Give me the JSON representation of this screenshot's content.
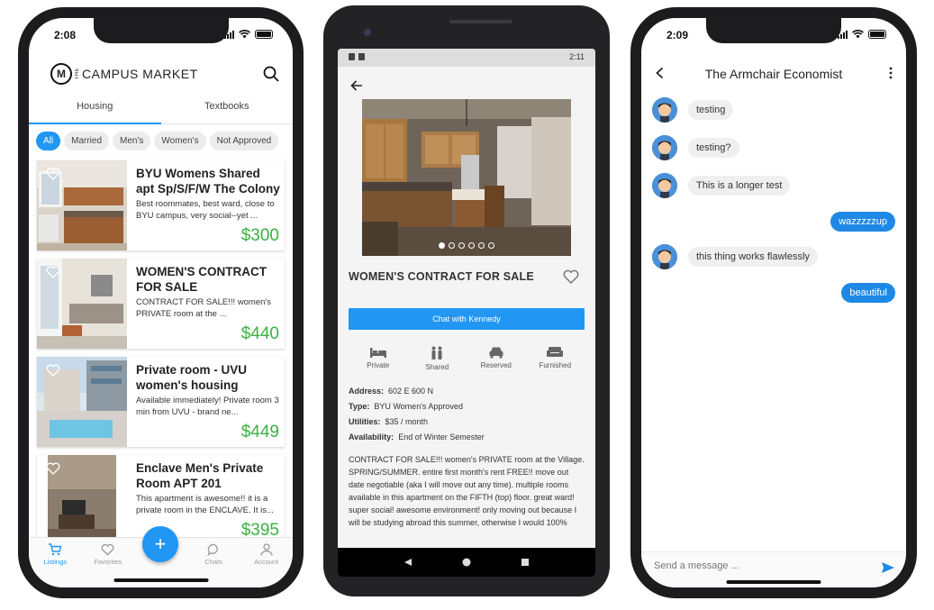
{
  "phone1": {
    "status_time": "2:08",
    "brand": {
      "letter": "M",
      "the": "THE",
      "name": "CAMPUS MARKET"
    },
    "tabs": [
      {
        "label": "Housing",
        "active": true
      },
      {
        "label": "Textbooks",
        "active": false
      }
    ],
    "filters": [
      {
        "label": "All",
        "active": true
      },
      {
        "label": "Married"
      },
      {
        "label": "Men's"
      },
      {
        "label": "Women's"
      },
      {
        "label": "Not Approved"
      }
    ],
    "listings": [
      {
        "title": "BYU Womens Shared apt Sp/S/F/W The Colony",
        "desc": "Best roommates, best ward, close to BYU campus, very social--yet ...",
        "price": "$300"
      },
      {
        "title": "WOMEN'S CONTRACT FOR SALE",
        "desc": "CONTRACT FOR SALE!!! women's PRIVATE room at the ...",
        "price": "$440"
      },
      {
        "title": "Private room - UVU women's housing",
        "desc": "Available immediately! Private room 3 min from UVU - brand ne...",
        "price": "$449"
      },
      {
        "title": "Enclave Men's Private Room APT 201",
        "desc": "This apartment is awesome!! it is a private room in the ENCLAVE. It is...",
        "price": "$395"
      }
    ],
    "fab_label": "+",
    "bottom_nav": [
      {
        "label": "Listings",
        "icon": "cart-icon",
        "active": true
      },
      {
        "label": "Favorites",
        "icon": "heart-icon"
      },
      {
        "label": "",
        "icon": ""
      },
      {
        "label": "Chats",
        "icon": "chat-icon"
      },
      {
        "label": "Account",
        "icon": "person-icon"
      }
    ],
    "accent_color": "#2196f3",
    "price_color": "#3cb043"
  },
  "phone2": {
    "status_time": "2:11",
    "title": "WOMEN'S CONTRACT FOR SALE",
    "chat_button": "Chat with Kennedy",
    "image_count": 6,
    "active_image": 0,
    "amenities": [
      {
        "label": "Private",
        "icon": "bed-icon"
      },
      {
        "label": "Shared",
        "icon": "people-icon"
      },
      {
        "label": "Reserved",
        "icon": "car-icon"
      },
      {
        "label": "Furnished",
        "icon": "sofa-icon"
      }
    ],
    "properties": [
      {
        "key": "Address:",
        "value": "602 E 600 N"
      },
      {
        "key": "Type:",
        "value": "BYU Women's Approved"
      },
      {
        "key": "Utilities:",
        "value": "$35 / month"
      },
      {
        "key": "Availability:",
        "value": "End of Winter Semester"
      }
    ],
    "description": "CONTRACT FOR SALE!!! women's PRIVATE room at the Village. SPRING/SUMMER. entire first month's rent FREE!! move out date negotiable (aka I will move out any time). multiple rooms available in this apartment on the FIFTH (top) floor. great ward! super social! awesome environment! only moving out because I will be studying abroad this summer, otherwise I would 100%"
  },
  "phone3": {
    "status_time": "2:09",
    "title": "The Armchair Economist",
    "messages": [
      {
        "text": "testing",
        "incoming": true
      },
      {
        "text": "testing?",
        "incoming": true
      },
      {
        "text": "This is a longer test",
        "incoming": true
      },
      {
        "text": "wazzzzzup",
        "incoming": false
      },
      {
        "text": "this thing works flawlessly",
        "incoming": true
      },
      {
        "text": "beautiful",
        "incoming": false
      }
    ],
    "composer_placeholder": "Send a message ...",
    "outgoing_color": "#1e88e5"
  }
}
